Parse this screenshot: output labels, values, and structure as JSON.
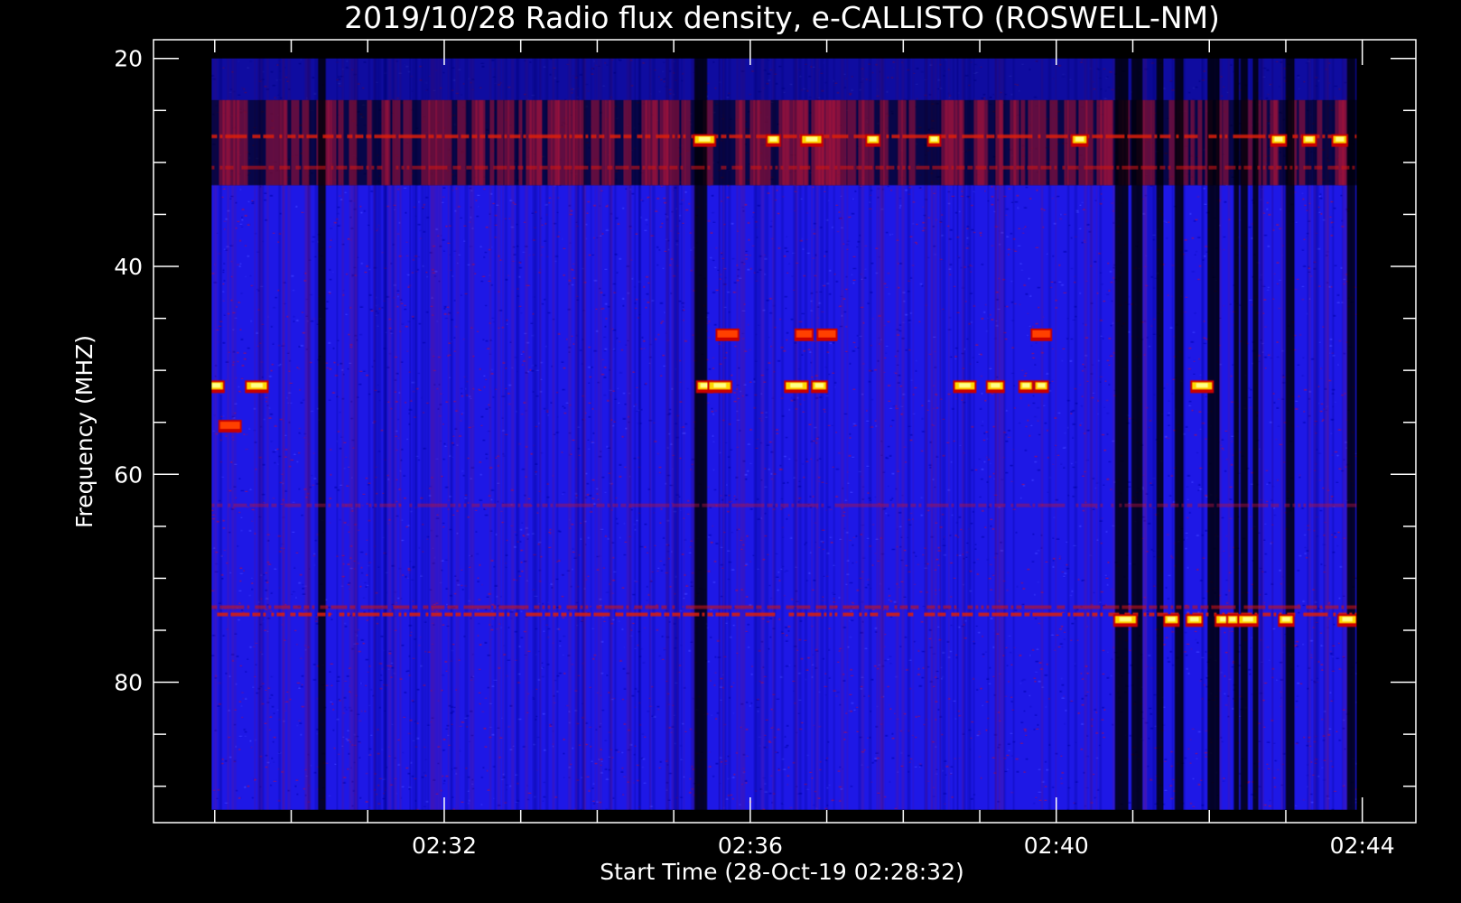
{
  "chart_data": {
    "type": "heatmap",
    "title": "2019/10/28  Radio flux density, e-CALLISTO (ROSWELL-NM)",
    "xlabel": "Start Time (28-Oct-19 02:28:32)",
    "ylabel": "Frequency (MHZ)",
    "x_tick_labels": [
      "02:32",
      "02:36",
      "02:40",
      "02:44"
    ],
    "y_tick_labels": [
      "20",
      "40",
      "60",
      "80"
    ],
    "y_axis": {
      "range": [
        18.2,
        93.5
      ],
      "inverted": true,
      "major_ticks": [
        20,
        40,
        60,
        80
      ],
      "minor_step": 5
    },
    "x_axis": {
      "start_minute": 28.2,
      "end_minute": 44.7,
      "major_ticks_minute": [
        32,
        36,
        40,
        44
      ],
      "minor_step_minute": 1
    },
    "data_extent": {
      "time_start_minute": 28.96,
      "time_end_minute": 43.92,
      "freq_top_mhz": 20.0,
      "freq_bottom_mhz": 92.3
    },
    "colormap": [
      "#000000",
      "#0a0ad0",
      "#1a1aff",
      "#c80000",
      "#ff4000",
      "#ffd700",
      "#ffff88"
    ],
    "background_color": "#1e18e6",
    "persistent_bands_mhz": [
      {
        "mhz": 27.5,
        "intensity": "high"
      },
      {
        "mhz": 30.5,
        "intensity": "medium"
      },
      {
        "mhz": 63.0,
        "intensity": "low"
      },
      {
        "mhz": 72.8,
        "intensity": "medium"
      },
      {
        "mhz": 73.5,
        "intensity": "high"
      }
    ],
    "bursts": [
      {
        "time_minute": 29.02,
        "freq_mhz": 51.5,
        "intensity": "high"
      },
      {
        "time_minute": 29.55,
        "freq_mhz": 51.5,
        "intensity": "high"
      },
      {
        "time_minute": 29.2,
        "freq_mhz": 55.3,
        "intensity": "medium"
      },
      {
        "time_minute": 35.4,
        "freq_mhz": 51.5,
        "intensity": "high"
      },
      {
        "time_minute": 35.6,
        "freq_mhz": 51.5,
        "intensity": "high"
      },
      {
        "time_minute": 35.7,
        "freq_mhz": 46.5,
        "intensity": "medium"
      },
      {
        "time_minute": 36.6,
        "freq_mhz": 51.5,
        "intensity": "high"
      },
      {
        "time_minute": 36.9,
        "freq_mhz": 51.5,
        "intensity": "high"
      },
      {
        "time_minute": 36.7,
        "freq_mhz": 46.5,
        "intensity": "medium"
      },
      {
        "time_minute": 37.0,
        "freq_mhz": 46.5,
        "intensity": "medium"
      },
      {
        "time_minute": 38.8,
        "freq_mhz": 51.5,
        "intensity": "high"
      },
      {
        "time_minute": 39.2,
        "freq_mhz": 51.5,
        "intensity": "high"
      },
      {
        "time_minute": 39.6,
        "freq_mhz": 51.5,
        "intensity": "high"
      },
      {
        "time_minute": 39.8,
        "freq_mhz": 51.5,
        "intensity": "high"
      },
      {
        "time_minute": 39.8,
        "freq_mhz": 46.5,
        "intensity": "medium"
      },
      {
        "time_minute": 41.9,
        "freq_mhz": 51.5,
        "intensity": "high"
      },
      {
        "time_minute": 40.9,
        "freq_mhz": 74.0,
        "intensity": "high"
      },
      {
        "time_minute": 41.5,
        "freq_mhz": 74.0,
        "intensity": "high"
      },
      {
        "time_minute": 41.8,
        "freq_mhz": 74.0,
        "intensity": "high"
      },
      {
        "time_minute": 42.2,
        "freq_mhz": 74.0,
        "intensity": "high"
      },
      {
        "time_minute": 42.3,
        "freq_mhz": 74.0,
        "intensity": "high"
      },
      {
        "time_minute": 42.5,
        "freq_mhz": 74.0,
        "intensity": "high"
      },
      {
        "time_minute": 43.0,
        "freq_mhz": 74.0,
        "intensity": "high"
      },
      {
        "time_minute": 43.8,
        "freq_mhz": 74.0,
        "intensity": "high"
      },
      {
        "time_minute": 35.4,
        "freq_mhz": 27.8,
        "intensity": "high"
      },
      {
        "time_minute": 36.3,
        "freq_mhz": 27.8,
        "intensity": "high"
      },
      {
        "time_minute": 36.8,
        "freq_mhz": 27.8,
        "intensity": "high"
      },
      {
        "time_minute": 37.6,
        "freq_mhz": 27.8,
        "intensity": "high"
      },
      {
        "time_minute": 38.4,
        "freq_mhz": 27.8,
        "intensity": "high"
      },
      {
        "time_minute": 40.3,
        "freq_mhz": 27.8,
        "intensity": "high"
      },
      {
        "time_minute": 42.9,
        "freq_mhz": 27.8,
        "intensity": "high"
      },
      {
        "time_minute": 43.3,
        "freq_mhz": 27.8,
        "intensity": "high"
      },
      {
        "time_minute": 43.7,
        "freq_mhz": 27.8,
        "intensity": "high"
      }
    ],
    "dark_time_columns_minute": [
      40.85,
      41.05,
      41.35,
      41.6,
      42.05,
      42.35,
      42.45,
      42.6,
      43.05,
      43.85,
      35.35,
      30.4
    ],
    "grid": false,
    "legend": "none"
  }
}
